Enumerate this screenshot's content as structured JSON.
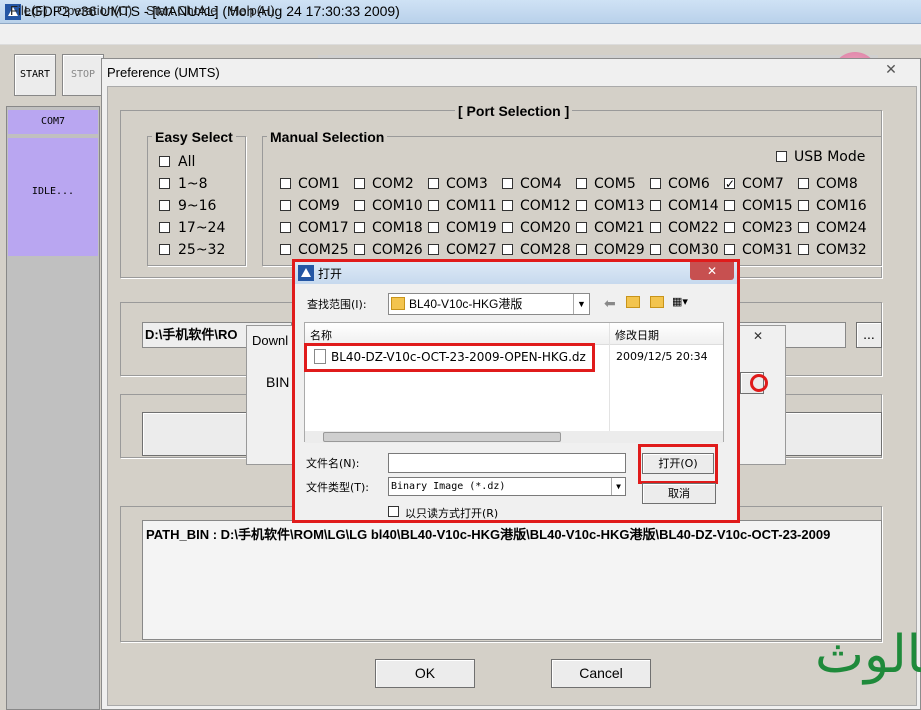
{
  "app": {
    "title": "LGDP2 v36 UMTS - [MANUAL] (Mon Aug 24 17:30:33 2009)",
    "menu": [
      "File(F)",
      "Operation(C)",
      "Start Choice",
      "Help(H)"
    ],
    "start_label": "START",
    "stop_label": "STOP",
    "port_com": "COM7",
    "port_status": "IDLE..."
  },
  "pref": {
    "title": "Preference (UMTS)",
    "close": "✕",
    "port_selection": "[ Port Selection ]",
    "easy_select": {
      "label": "Easy Select",
      "items": [
        "All",
        "1~8",
        "9~16",
        "17~24",
        "25~32"
      ]
    },
    "manual": {
      "label": "Manual Selection",
      "usb_mode": "USB Mode",
      "checked": "COM7",
      "ports": [
        [
          "COM1",
          "COM2",
          "COM3",
          "COM4",
          "COM5",
          "COM6",
          "COM7",
          "COM8"
        ],
        [
          "COM9",
          "COM10",
          "COM11",
          "COM12",
          "COM13",
          "COM14",
          "COM15",
          "COM16"
        ],
        [
          "COM17",
          "COM18",
          "COM19",
          "COM20",
          "COM21",
          "COM22",
          "COM23",
          "COM24"
        ],
        [
          "COM25",
          "COM26",
          "COM27",
          "COM28",
          "COM29",
          "COM30",
          "COM31",
          "COM32"
        ]
      ]
    },
    "path_prefix": "D:\\手机软件\\RO",
    "browse": "...",
    "log": "PATH_BIN : D:\\手机软件\\ROM\\LG\\LG bl40\\BL40-V10c-HKG港版\\BL40-V10c-HKG港版\\BL40-DZ-V10c-OCT-23-2009",
    "ok": "OK",
    "cancel": "Cancel"
  },
  "download": {
    "title": "Downl",
    "bin": "BIN",
    "close": "✕",
    "dots": "."
  },
  "open_dialog": {
    "title": "打开",
    "look_in_label": "查找范围(I):",
    "look_in_value": "BL40-V10c-HKG港版",
    "col_name": "名称",
    "col_date": "修改日期",
    "file_name": "BL40-DZ-V10c-OCT-23-2009-OPEN-HKG.dz",
    "file_date": "2009/12/5 20:34",
    "filename_label": "文件名(N):",
    "filetype_label": "文件类型(T):",
    "filetype_value": "Binary Image (*.dz)",
    "readonly_label": "以只读方式打开(R)",
    "open_btn": "打开(O)",
    "cancel_btn": "取消",
    "close": "✕"
  },
  "watermark": "ثالوث"
}
